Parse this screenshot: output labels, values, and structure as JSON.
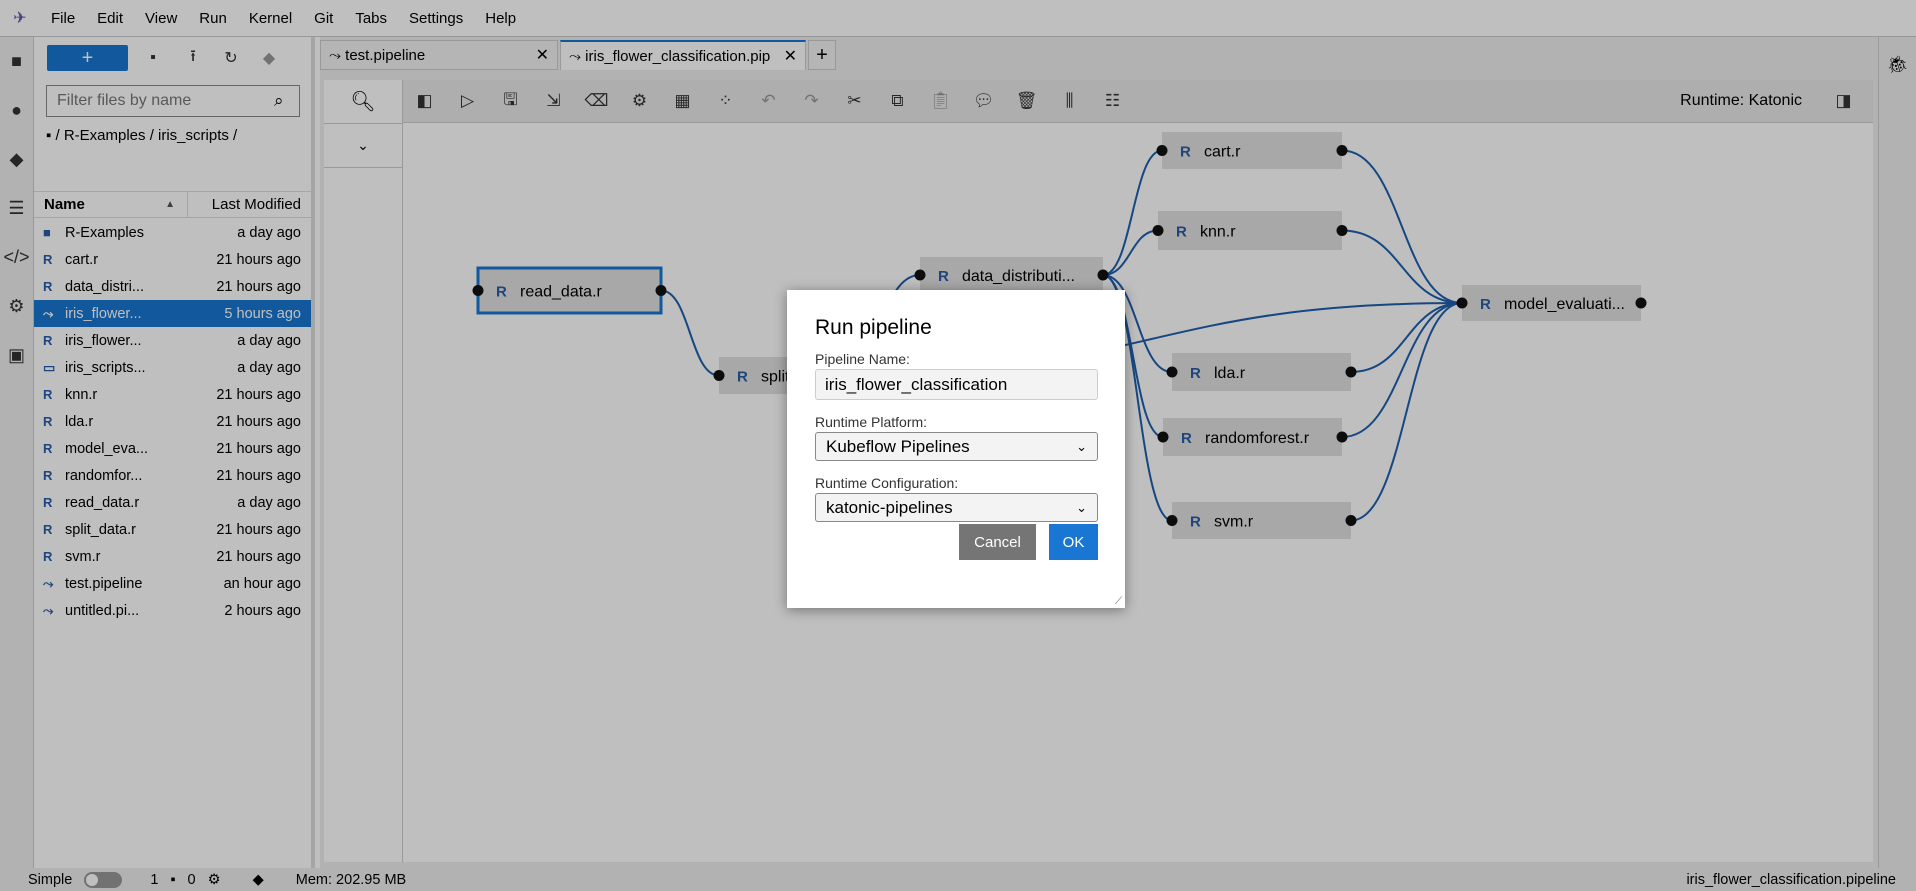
{
  "menu": [
    "File",
    "Edit",
    "View",
    "Run",
    "Kernel",
    "Git",
    "Tabs",
    "Settings",
    "Help"
  ],
  "filebrowser": {
    "new_label": "+",
    "filter_placeholder": "Filter files by name",
    "breadcrumb": "/ R-Examples / iris_scripts /",
    "col_name": "Name",
    "col_modified": "Last Modified",
    "files": [
      {
        "icon": "folder",
        "name": "R-Examples",
        "modified": "a day ago"
      },
      {
        "icon": "r",
        "name": "cart.r",
        "modified": "21 hours ago"
      },
      {
        "icon": "r",
        "name": "data_distri...",
        "modified": "21 hours ago"
      },
      {
        "icon": "pipeline",
        "name": "iris_flower...",
        "modified": "5 hours ago",
        "selected": true
      },
      {
        "icon": "r",
        "name": "iris_flower...",
        "modified": "a day ago"
      },
      {
        "icon": "file",
        "name": "iris_scripts...",
        "modified": "a day ago"
      },
      {
        "icon": "r",
        "name": "knn.r",
        "modified": "21 hours ago"
      },
      {
        "icon": "r",
        "name": "lda.r",
        "modified": "21 hours ago"
      },
      {
        "icon": "r",
        "name": "model_eva...",
        "modified": "21 hours ago"
      },
      {
        "icon": "r",
        "name": "randomfor...",
        "modified": "21 hours ago"
      },
      {
        "icon": "r",
        "name": "read_data.r",
        "modified": "a day ago"
      },
      {
        "icon": "r",
        "name": "split_data.r",
        "modified": "21 hours ago"
      },
      {
        "icon": "r",
        "name": "svm.r",
        "modified": "21 hours ago"
      },
      {
        "icon": "pipeline",
        "name": "test.pipeline",
        "modified": "an hour ago"
      },
      {
        "icon": "pipeline",
        "name": "untitled.pi...",
        "modified": "2 hours ago"
      }
    ]
  },
  "tabs": [
    {
      "label": "test.pipeline"
    },
    {
      "label": "iris_flower_classification.pip",
      "active": true
    }
  ],
  "toolbar": {
    "runtime": "Runtime: Katonic"
  },
  "nodes": [
    "read_data.r",
    "split",
    "data_distributi...",
    "cart.r",
    "knn.r",
    "model_evaluati...",
    "lda.r",
    "randomforest.r",
    "svm.r"
  ],
  "dialog": {
    "title": "Run pipeline",
    "name_label": "Pipeline Name:",
    "name_value": "iris_flower_classification",
    "platform_label": "Runtime Platform:",
    "platform_value": "Kubeflow Pipelines",
    "config_label": "Runtime Configuration:",
    "config_value": "katonic-pipelines",
    "cancel": "Cancel",
    "ok": "OK"
  },
  "status": {
    "mode": "Simple",
    "kernels": "1",
    "terminals": "0",
    "mem": "Mem: 202.95 MB",
    "file": "iris_flower_classification.pipeline"
  },
  "colors": {
    "accent": "#1976d2",
    "link": "#1f5fae"
  }
}
